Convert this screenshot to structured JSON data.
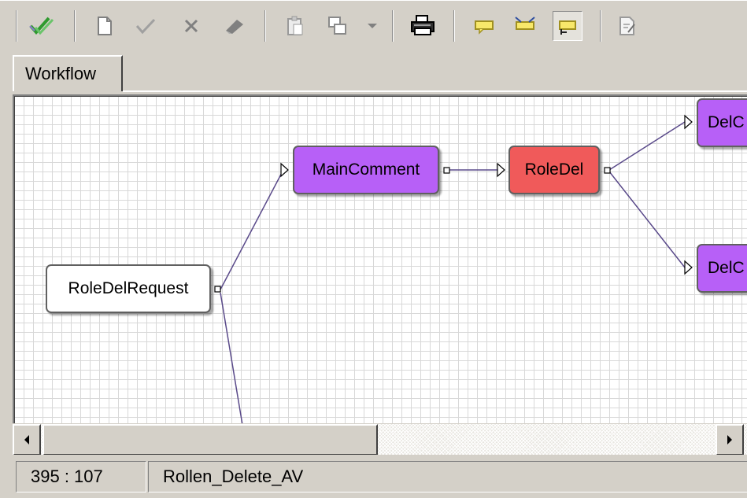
{
  "toolbar": {
    "buttons": [
      {
        "name": "validate",
        "icon": "double-check-icon"
      },
      {
        "name": "new",
        "icon": "new-document-icon"
      },
      {
        "name": "accept",
        "icon": "check-icon"
      },
      {
        "name": "delete",
        "icon": "x-icon"
      },
      {
        "name": "erase",
        "icon": "eraser-icon"
      },
      {
        "name": "paste",
        "icon": "clipboard-icon"
      },
      {
        "name": "copy-layout",
        "icon": "windows-icon"
      },
      {
        "name": "copy-layout-dropdown",
        "icon": "dropdown-arrow-icon"
      },
      {
        "name": "print",
        "icon": "printer-icon"
      },
      {
        "name": "comment-left",
        "icon": "note-icon"
      },
      {
        "name": "comment-link",
        "icon": "note-link-icon"
      },
      {
        "name": "comment-right",
        "icon": "note-right-icon"
      },
      {
        "name": "properties",
        "icon": "document-edit-icon"
      }
    ]
  },
  "tabs": [
    {
      "label": "Workflow",
      "active": true
    }
  ],
  "workflow": {
    "nodes": [
      {
        "id": "n1",
        "label": "RoleDelRequest",
        "color": "#ffffff"
      },
      {
        "id": "n2",
        "label": "MainComment",
        "color": "#b760f7"
      },
      {
        "id": "n3",
        "label": "RoleDel",
        "color": "#f05a5a"
      },
      {
        "id": "n4",
        "label": "DelC",
        "color": "#b760f7"
      },
      {
        "id": "n5",
        "label": "DelC",
        "color": "#b760f7"
      }
    ],
    "edges": [
      {
        "from": "RoleDelRequest",
        "to": "MainComment"
      },
      {
        "from": "MainComment",
        "to": "RoleDel"
      },
      {
        "from": "RoleDel",
        "to": "DelC"
      },
      {
        "from": "RoleDel",
        "to": "DelC"
      }
    ]
  },
  "colors": {
    "edge": "#5a4a8a",
    "grid": "#d8d8d8",
    "chrome": "#d4d0c8"
  },
  "statusbar": {
    "coords": "395 : 107",
    "workflow_name": "Rollen_Delete_AV"
  }
}
